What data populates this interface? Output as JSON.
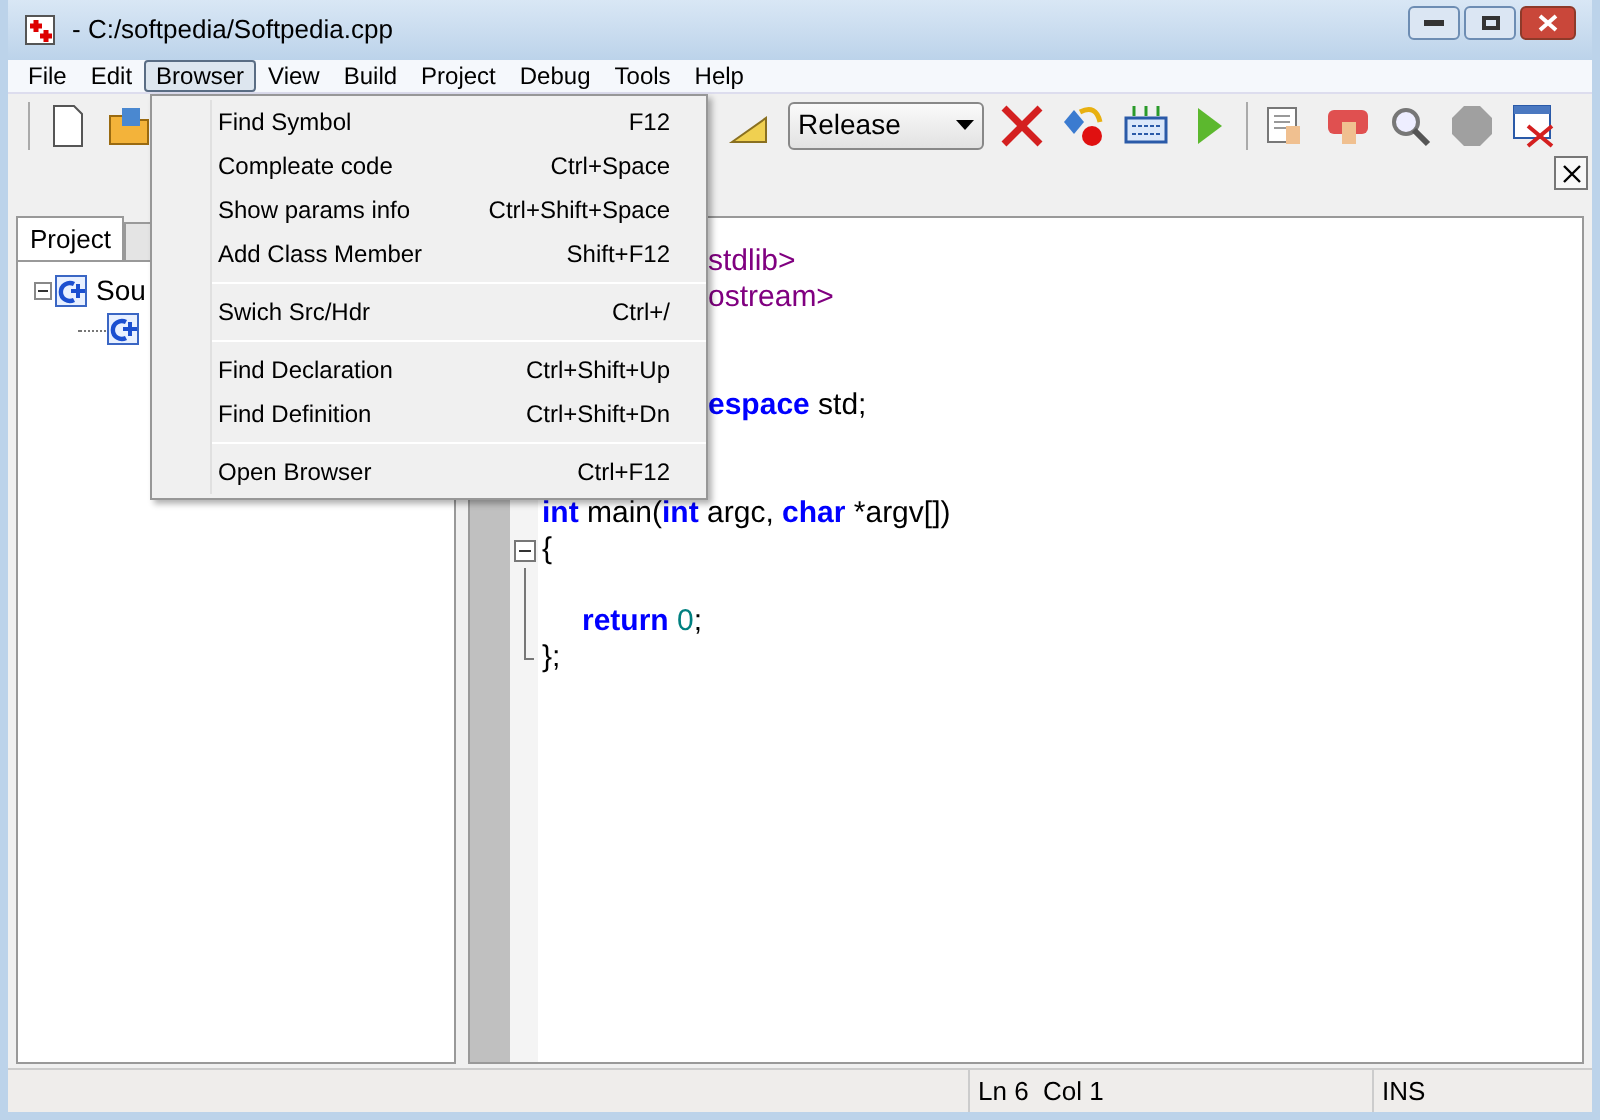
{
  "window": {
    "title": "- C:/softpedia/Softpedia.cpp"
  },
  "menu_bar": [
    {
      "label": "File",
      "selected": false
    },
    {
      "label": "Edit",
      "selected": false
    },
    {
      "label": "Browser",
      "selected": true
    },
    {
      "label": "View",
      "selected": false
    },
    {
      "label": "Build",
      "selected": false
    },
    {
      "label": "Project",
      "selected": false
    },
    {
      "label": "Debug",
      "selected": false
    },
    {
      "label": "Tools",
      "selected": false
    },
    {
      "label": "Help",
      "selected": false
    }
  ],
  "browser_menu": [
    {
      "label": "Find Symbol",
      "shortcut": "F12",
      "separator_after": false
    },
    {
      "label": "Compleate code",
      "shortcut": "Ctrl+Space",
      "separator_after": false
    },
    {
      "label": "Show params info",
      "shortcut": "Ctrl+Shift+Space",
      "separator_after": false
    },
    {
      "label": "Add Class Member",
      "shortcut": "Shift+F12",
      "separator_after": true
    },
    {
      "label": "Swich Src/Hdr",
      "shortcut": "Ctrl+/",
      "separator_after": true
    },
    {
      "label": "Find Declaration",
      "shortcut": "Ctrl+Shift+Up",
      "separator_after": false
    },
    {
      "label": "Find Definition",
      "shortcut": "Ctrl+Shift+Dn",
      "separator_after": true
    },
    {
      "label": "Open Browser",
      "shortcut": "Ctrl+F12",
      "separator_after": false
    }
  ],
  "toolbar": {
    "configuration": "Release"
  },
  "sidebar": {
    "tabs": [
      {
        "label": "Project",
        "selected": true
      }
    ],
    "tree": [
      {
        "label": "Sou",
        "expanded": true,
        "children": [
          {
            "kind": "cpp"
          }
        ]
      }
    ]
  },
  "editor": {
    "lines": [
      {
        "kind": "code",
        "covered": true,
        "space_after": false,
        "segments": [
          {
            "text": "stdlib>",
            "kind": "include"
          }
        ]
      },
      {
        "kind": "code",
        "covered": true,
        "space_after": true,
        "segments": [
          {
            "text": "ostream>",
            "kind": "include"
          }
        ]
      },
      {
        "kind": "code",
        "covered": true,
        "space_after": true,
        "segments": [
          {
            "text": "espace",
            "kind": "keyword"
          },
          {
            "text": " std;",
            "kind": "plain"
          }
        ]
      },
      {
        "kind": "code",
        "covered": false,
        "space_after": false,
        "segments": [
          {
            "text": "int",
            "kind": "keyword"
          },
          {
            "text": " main(",
            "kind": "plain"
          },
          {
            "text": "int",
            "kind": "keyword"
          },
          {
            "text": " argc, ",
            "kind": "plain"
          },
          {
            "text": "char",
            "kind": "keyword"
          },
          {
            "text": " *argv[])",
            "kind": "plain"
          }
        ]
      },
      {
        "kind": "fold_start",
        "segments": [
          {
            "text": "{",
            "kind": "plain"
          }
        ]
      },
      {
        "kind": "fold_body"
      },
      {
        "kind": "fold_body",
        "indented": true,
        "segments": [
          {
            "text": "return ",
            "kind": "keyword"
          },
          {
            "text": "0",
            "kind": "number"
          },
          {
            "text": ";",
            "kind": "plain"
          }
        ]
      },
      {
        "kind": "fold_end",
        "segments": [
          {
            "text": "};",
            "kind": "plain"
          }
        ]
      }
    ]
  },
  "status_bar": {
    "position": "Ln 6  Col 1",
    "mode": "INS"
  }
}
